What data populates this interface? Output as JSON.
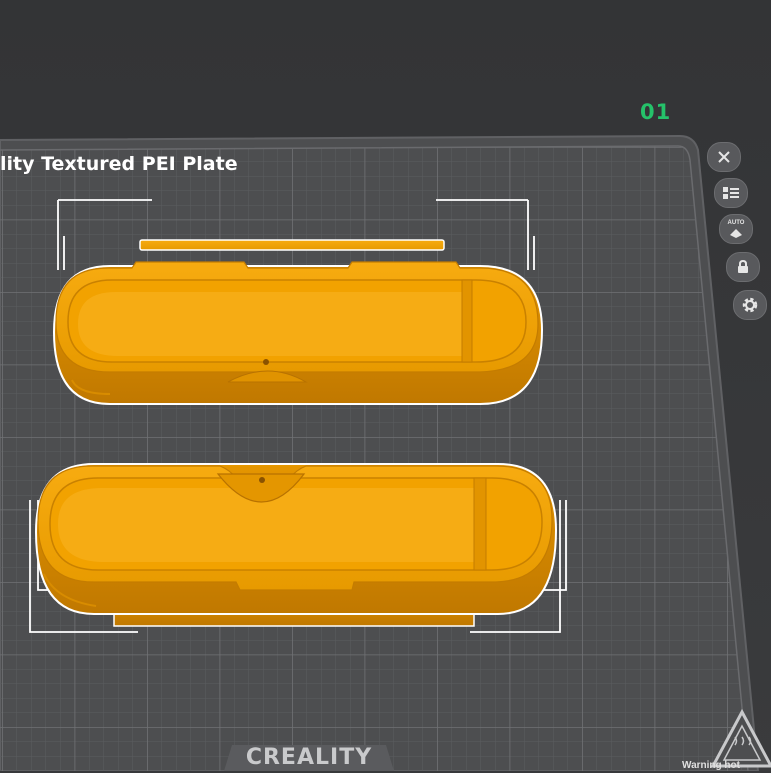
{
  "plate": {
    "index": "01",
    "name": "lity Textured PEI Plate",
    "brand": "CREALITY",
    "corner_hint": "Warning hot"
  },
  "colors": {
    "background": "#38393b",
    "plate": "#4d4e50",
    "grid_line": "#5f6063",
    "model": "#f4a400",
    "model_edge": "#c17a00",
    "selection": "#ffffff",
    "plate_index": "#25c26a"
  },
  "toolbar": {
    "items": [
      {
        "name": "close-plate",
        "icon": "close-icon"
      },
      {
        "name": "arrange",
        "icon": "list-icon"
      },
      {
        "name": "auto-orient",
        "icon": "auto-icon",
        "label": "AUTO"
      },
      {
        "name": "lock-plate",
        "icon": "lock-icon"
      },
      {
        "name": "plate-settings",
        "icon": "gear-icon"
      }
    ]
  },
  "objects": [
    {
      "name": "case-lid",
      "color": "#f4a400"
    },
    {
      "name": "case-base",
      "color": "#f4a400"
    }
  ]
}
